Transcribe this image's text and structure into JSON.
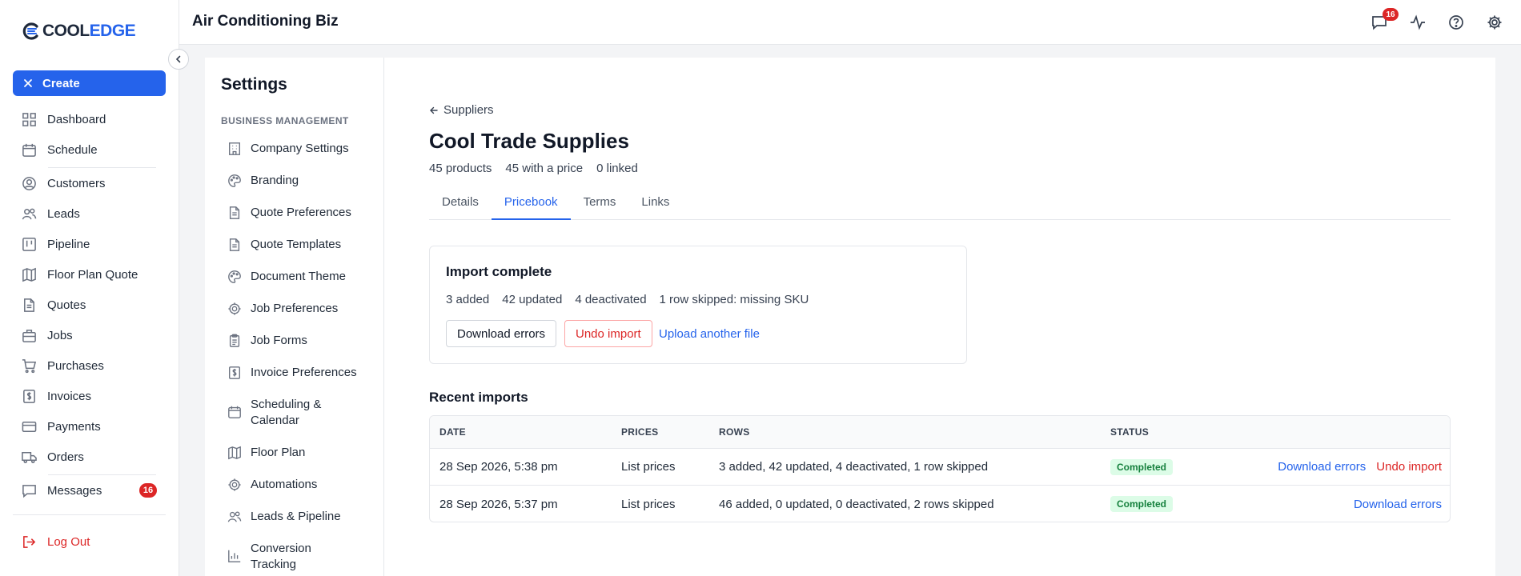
{
  "brand": {
    "logo_part1": "COOL",
    "logo_part2": "EDGE"
  },
  "sidebar": {
    "create_label": "Create",
    "items": [
      {
        "label": "Dashboard",
        "icon": "grid-icon"
      },
      {
        "label": "Schedule",
        "icon": "calendar-icon"
      },
      {
        "label": "Customers",
        "icon": "user-circle-icon"
      },
      {
        "label": "Leads",
        "icon": "users-icon"
      },
      {
        "label": "Pipeline",
        "icon": "kanban-icon"
      },
      {
        "label": "Floor Plan Quote",
        "icon": "map-icon"
      },
      {
        "label": "Quotes",
        "icon": "document-icon"
      },
      {
        "label": "Jobs",
        "icon": "briefcase-icon"
      },
      {
        "label": "Purchases",
        "icon": "cart-icon"
      },
      {
        "label": "Invoices",
        "icon": "dollar-doc-icon"
      },
      {
        "label": "Payments",
        "icon": "credit-card-icon"
      },
      {
        "label": "Orders",
        "icon": "truck-icon"
      },
      {
        "label": "Messages",
        "icon": "chat-icon"
      }
    ],
    "messages_badge": "16",
    "logout_label": "Log Out"
  },
  "topbar": {
    "title": "Air Conditioning Biz",
    "notification_badge": "16"
  },
  "settings": {
    "title": "Settings",
    "section_label": "BUSINESS MANAGEMENT",
    "items": [
      {
        "label": "Company Settings"
      },
      {
        "label": "Branding"
      },
      {
        "label": "Quote Preferences"
      },
      {
        "label": "Quote Templates"
      },
      {
        "label": "Document Theme"
      },
      {
        "label": "Job Preferences"
      },
      {
        "label": "Job Forms"
      },
      {
        "label": "Invoice Preferences"
      },
      {
        "label": "Scheduling &",
        "label2": "Calendar"
      },
      {
        "label": "Floor Plan"
      },
      {
        "label": "Automations"
      },
      {
        "label": "Leads & Pipeline"
      },
      {
        "label": "Conversion",
        "label2": "Tracking"
      }
    ]
  },
  "main": {
    "back_label": "Suppliers",
    "title": "Cool Trade Supplies",
    "stats": [
      "45 products",
      "45 with a price",
      "0 linked"
    ],
    "tabs": [
      "Details",
      "Pricebook",
      "Terms",
      "Links"
    ],
    "active_tab": "Pricebook",
    "import": {
      "title": "Import complete",
      "stats": [
        "3 added",
        "42 updated",
        "4 deactivated",
        "1 row skipped: missing SKU"
      ],
      "download_errors": "Download errors",
      "undo_import": "Undo import",
      "upload_another": "Upload another file"
    },
    "recent": {
      "title": "Recent imports",
      "columns": [
        "DATE",
        "PRICES",
        "ROWS",
        "STATUS"
      ],
      "rows": [
        {
          "date": "28 Sep 2026, 5:38 pm",
          "prices": "List prices",
          "rows": "3 added, 42 updated, 4 deactivated, 1 row skipped",
          "status": "Completed",
          "download": "Download errors",
          "undo": "Undo import"
        },
        {
          "date": "28 Sep 2026, 5:37 pm",
          "prices": "List prices",
          "rows": "46 added, 0 updated, 0 deactivated, 2 rows skipped",
          "status": "Completed",
          "download": "Download errors"
        }
      ]
    }
  },
  "colors": {
    "accent": "#2563eb",
    "danger": "#dc2626",
    "success_bg": "#dcfce7",
    "success_text": "#15803d"
  }
}
